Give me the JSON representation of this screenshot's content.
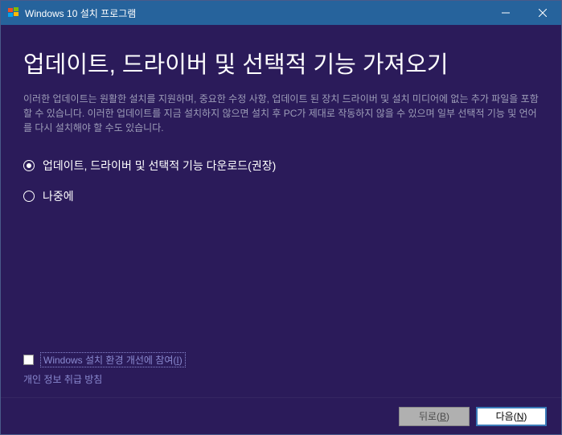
{
  "titlebar": {
    "title": "Windows 10 설치 프로그램"
  },
  "content": {
    "heading": "업데이트, 드라이버 및 선택적 기능 가져오기",
    "description": "이러한 업데이트는 원활한 설치를 지원하며, 중요한 수정 사항, 업데이트 된 장치 드라이버 및 설치 미디어에 없는 추가 파일을 포함할 수 있습니다. 이러한 업데이트를 지금 설치하지 않으면 설치 후 PC가 제대로 작동하지 않을 수 있으며 일부 선택적 기능 및 언어를 다시 설치해야 할 수도 있습니다."
  },
  "options": {
    "download": "업데이트, 드라이버 및 선택적 기능 다운로드(권장)",
    "later": "나중에"
  },
  "bottom": {
    "checkbox_label_prefix": "Windows 설치 환경 개선에 참여(",
    "checkbox_label_key": "I",
    "checkbox_label_suffix": ")",
    "privacy": "개인 정보 취급 방침"
  },
  "buttons": {
    "back_prefix": "뒤로(",
    "back_key": "B",
    "back_suffix": ")",
    "next_prefix": "다음(",
    "next_key": "N",
    "next_suffix": ")"
  }
}
